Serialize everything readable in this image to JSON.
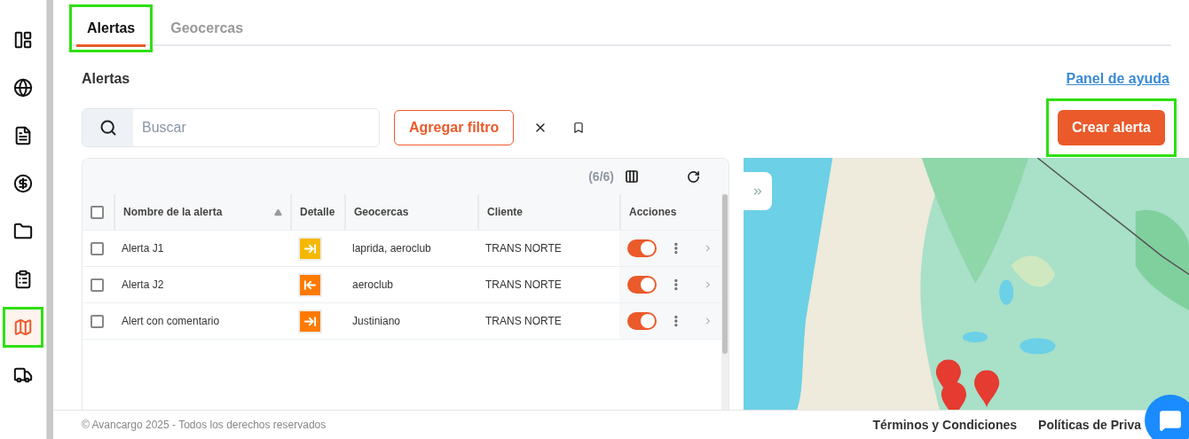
{
  "sidebar": {
    "items": [
      {
        "selected": false,
        "highlighted": false
      },
      {
        "selected": false,
        "highlighted": false
      },
      {
        "selected": false,
        "highlighted": false
      },
      {
        "selected": false,
        "highlighted": false
      },
      {
        "selected": false,
        "highlighted": false
      },
      {
        "selected": false,
        "highlighted": false
      },
      {
        "selected": true,
        "highlighted": true
      },
      {
        "selected": false,
        "highlighted": false
      }
    ]
  },
  "tabs": [
    {
      "label": "Alertas",
      "selected": true,
      "highlighted": true
    },
    {
      "label": "Geocercas",
      "selected": false,
      "highlighted": false
    }
  ],
  "heading": "Alertas",
  "help_link": "Panel de ayuda",
  "search": {
    "placeholder": "Buscar"
  },
  "filter_button": "Agregar filtro",
  "create_button": {
    "label": "Crear alerta",
    "highlighted": true
  },
  "table": {
    "count": "(6/6)",
    "header_checked": false,
    "columns": [
      "Nombre de la alerta",
      "Detalle",
      "Geocercas",
      "Cliente",
      "Acciones"
    ],
    "rows": [
      {
        "checked": false,
        "name": "Alerta J1",
        "detail": {
          "kind": "enter",
          "color": "#f5b800"
        },
        "geofences": "laprida, aeroclub",
        "client": "TRANS NORTE",
        "on": true
      },
      {
        "checked": false,
        "name": "Alerta J2",
        "detail": {
          "kind": "exit",
          "color": "#ff7a00"
        },
        "geofences": "aeroclub",
        "client": "TRANS NORTE",
        "on": true
      },
      {
        "checked": false,
        "name": "Alert con comentario",
        "detail": {
          "kind": "enter",
          "color": "#ff7a00"
        },
        "geofences": "Justiniano",
        "client": "TRANS NORTE",
        "on": true
      }
    ]
  },
  "footer": {
    "copyright": "© Avancargo 2025 - Todos los derechos reservados",
    "links": [
      "Términos y Condiciones",
      "Políticas de Priva"
    ]
  }
}
